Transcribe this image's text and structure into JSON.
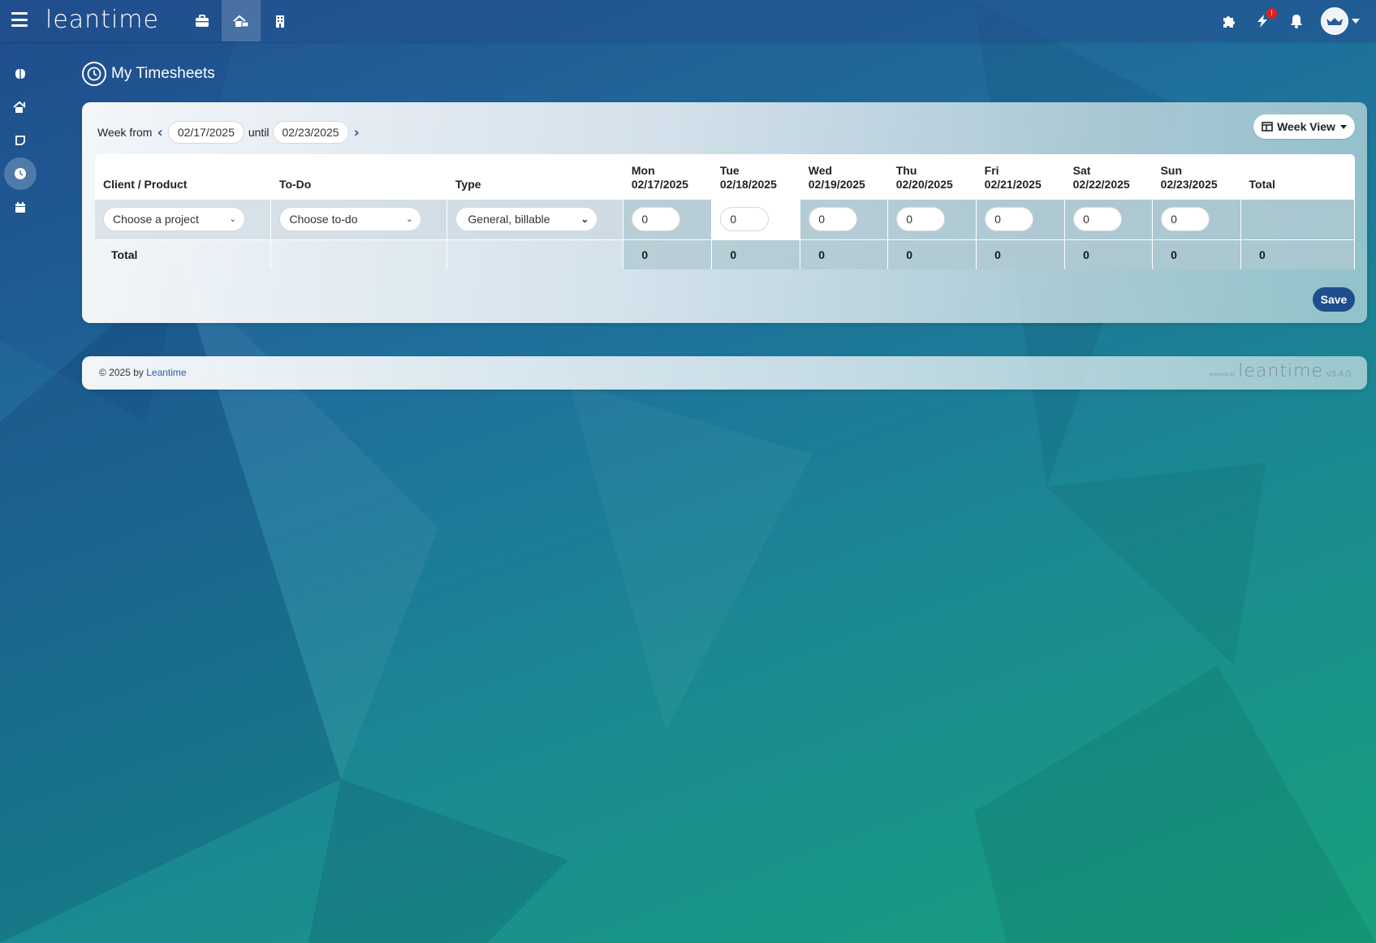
{
  "app": {
    "logo": "leantime",
    "title": "My Timesheets"
  },
  "header": {
    "nav": [
      {
        "name": "briefcase-icon"
      },
      {
        "name": "home-work-icon"
      },
      {
        "name": "building-icon"
      }
    ],
    "notification_badge": "!"
  },
  "sidebar": {
    "items": [
      {
        "name": "brain-icon"
      },
      {
        "name": "home-icon"
      },
      {
        "name": "note-icon"
      },
      {
        "name": "clock-icon",
        "active": true
      },
      {
        "name": "calendar-icon"
      }
    ]
  },
  "week": {
    "from_label": "Week from",
    "from": "02/17/2025",
    "until_label": "until",
    "until": "02/23/2025",
    "view_label": "Week View"
  },
  "table": {
    "headers": {
      "client": "Client / Product",
      "todo": "To-Do",
      "type": "Type",
      "total": "Total"
    },
    "days": [
      {
        "day": "Mon",
        "date": "02/17/2025",
        "value": "0",
        "total": "0"
      },
      {
        "day": "Tue",
        "date": "02/18/2025",
        "value": "0",
        "total": "0"
      },
      {
        "day": "Wed",
        "date": "02/19/2025",
        "value": "0",
        "total": "0"
      },
      {
        "day": "Thu",
        "date": "02/20/2025",
        "value": "0",
        "total": "0"
      },
      {
        "day": "Fri",
        "date": "02/21/2025",
        "value": "0",
        "total": "0"
      },
      {
        "day": "Sat",
        "date": "02/22/2025",
        "value": "0",
        "total": "0"
      },
      {
        "day": "Sun",
        "date": "02/23/2025",
        "value": "0",
        "total": "0"
      }
    ],
    "row": {
      "project_placeholder": "Choose a project",
      "todo_placeholder": "Choose to-do",
      "type_value": "General, billable"
    },
    "totals_label": "Total",
    "grand_total": "0"
  },
  "actions": {
    "save": "Save"
  },
  "footer": {
    "copyright": "© 2025 by",
    "link": "Leantime",
    "powered_by": "powered by",
    "powered_logo": "leantime",
    "version": "v3.4.0"
  },
  "colors": {
    "primary": "#1f4e8c",
    "link": "#2a5ea8",
    "badge": "#e02020"
  }
}
